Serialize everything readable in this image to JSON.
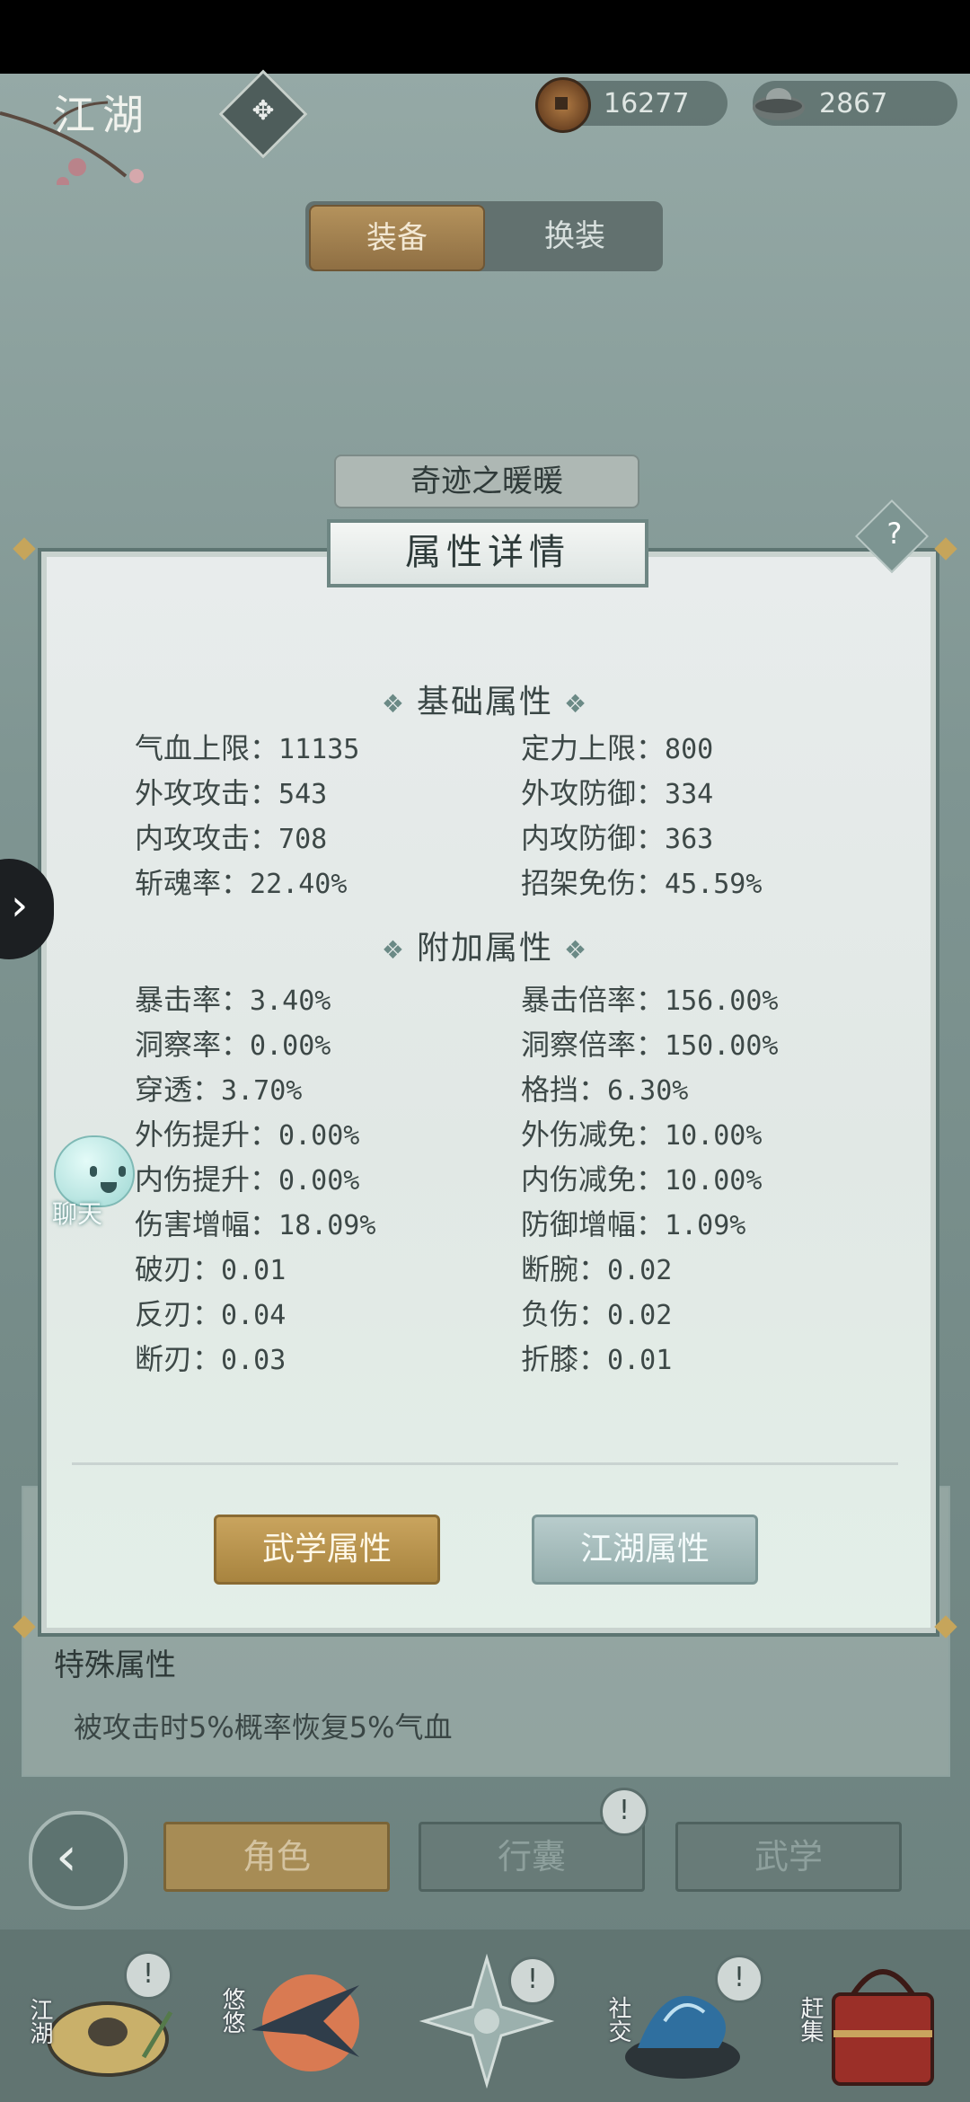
{
  "header": {
    "region_title": "江湖",
    "region_icon": "compass-icon",
    "coins": "16277",
    "silver": "2867"
  },
  "equip_tabs": {
    "equip": "装备",
    "change": "换装"
  },
  "equipment_name": "奇迹之暖暖",
  "dialog": {
    "title": "属性详情",
    "help": "?",
    "basic_title": "基础属性",
    "basic": [
      {
        "label": "气血上限：",
        "value": "11135"
      },
      {
        "label": "定力上限：",
        "value": "800"
      },
      {
        "label": "外攻攻击：",
        "value": "543"
      },
      {
        "label": "外攻防御：",
        "value": "334"
      },
      {
        "label": "内攻攻击：",
        "value": "708"
      },
      {
        "label": "内攻防御：",
        "value": "363"
      },
      {
        "label": "斩魂率：",
        "value": "22.40%"
      },
      {
        "label": "招架免伤：",
        "value": "45.59%"
      }
    ],
    "extra_title": "附加属性",
    "extra": [
      {
        "label": "暴击率：",
        "value": "3.40%"
      },
      {
        "label": "暴击倍率：",
        "value": "156.00%"
      },
      {
        "label": "洞察率：",
        "value": "0.00%"
      },
      {
        "label": "洞察倍率：",
        "value": "150.00%"
      },
      {
        "label": "穿透：",
        "value": "3.70%"
      },
      {
        "label": "格挡：",
        "value": "6.30%"
      },
      {
        "label": "外伤提升：",
        "value": "0.00%"
      },
      {
        "label": "外伤减免：",
        "value": "10.00%"
      },
      {
        "label": "内伤提升：",
        "value": "0.00%"
      },
      {
        "label": "内伤减免：",
        "value": "10.00%"
      },
      {
        "label": "伤害增幅：",
        "value": "18.09%"
      },
      {
        "label": "防御增幅：",
        "value": "1.09%"
      },
      {
        "label": "破刃：",
        "value": "0.01"
      },
      {
        "label": "断腕：",
        "value": "0.02"
      },
      {
        "label": "反刃：",
        "value": "0.04"
      },
      {
        "label": "负伤：",
        "value": "0.02"
      },
      {
        "label": "断刃：",
        "value": "0.03"
      },
      {
        "label": "折膝：",
        "value": "0.01"
      }
    ],
    "btn_martial": "武学属性",
    "btn_jianghu": "江湖属性"
  },
  "chat_label": "聊天",
  "special": {
    "title": "特殊属性",
    "text": "被攻击时5%概率恢复5%气血"
  },
  "nav": {
    "role": "角色",
    "bag": "行囊",
    "wuxue": "武学",
    "alert": "!"
  },
  "bottom": {
    "jianghu": "江湖",
    "youyou": "悠悠",
    "social": "社交",
    "market": "赶集"
  },
  "colors": {
    "gold": "#c9a45e",
    "teal": "#94adac",
    "panel": "#e1e8e5"
  }
}
